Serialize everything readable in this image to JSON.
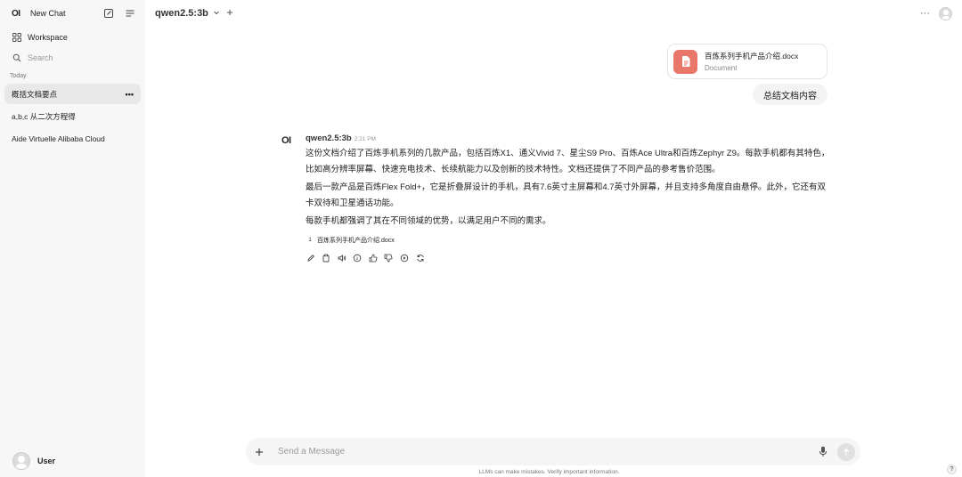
{
  "sidebar": {
    "logo": "OI",
    "new_chat_label": "New Chat",
    "workspace_label": "Workspace",
    "search_placeholder": "Search",
    "section_today": "Today",
    "chats": [
      {
        "title": "概括文档要点",
        "active": true
      },
      {
        "title": "a,b,c 从二次方程得",
        "active": false
      },
      {
        "title": "Aide Virtuelle Alibaba Cloud",
        "active": false
      }
    ],
    "more_label": "•••",
    "user_name": "User"
  },
  "topbar": {
    "model_name": "qwen2.5:3b",
    "menu_label": "···"
  },
  "user_message": {
    "file": {
      "name": "百炼系列手机产品介绍.docx",
      "type": "Document"
    },
    "text": "总结文档内容"
  },
  "assistant_message": {
    "logo": "OI",
    "name": "qwen2.5:3b",
    "time": "2:21 PM",
    "paragraphs": [
      "这份文档介绍了百炼手机系列的几款产品，包括百炼X1、通义Vivid 7、星尘S9 Pro、百炼Ace Ultra和百炼Zephyr Z9。每款手机都有其特色，比如高分辨率屏幕、快速充电技术、长续航能力以及创新的技术特性。文档还提供了不同产品的参考售价范围。",
      "最后一款产品是百炼Flex Fold+，它是折叠屏设计的手机，具有7.6英寸主屏幕和4.7英寸外屏幕，并且支持多角度自由悬停。此外，它还有双卡双待和卫星通话功能。",
      "每款手机都强调了其在不同领域的优势，以满足用户不同的需求。"
    ],
    "citation": {
      "number": "1",
      "file": "百炼系列手机产品介绍.docx"
    },
    "actions": [
      "edit-icon",
      "copy-icon",
      "read-aloud-icon",
      "info-icon",
      "thumbs-up-icon",
      "thumbs-down-icon",
      "continue-icon",
      "regenerate-icon"
    ]
  },
  "input": {
    "placeholder": "Send a Message",
    "value": ""
  },
  "footer": {
    "disclaimer": "LLMs can make mistakes. Verify important information.",
    "help_label": "?"
  },
  "colors": {
    "sidebar_bg": "#f7f7f7",
    "active_chat_bg": "#e8e8e8",
    "file_icon_bg": "#e8776a",
    "bubble_bg": "#f3f3f3"
  }
}
